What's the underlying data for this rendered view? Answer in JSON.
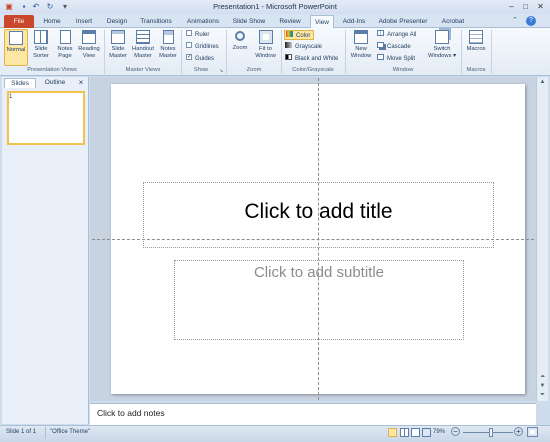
{
  "window": {
    "title": "Presentation1 - Microsoft PowerPoint",
    "quick_access": [
      "save-icon",
      "undo-icon",
      "redo-icon",
      "customize-icon"
    ],
    "controls": {
      "minimize": "–",
      "maximize": "□",
      "close": "✕"
    }
  },
  "tabs": [
    "File",
    "Home",
    "Insert",
    "Design",
    "Transitions",
    "Animations",
    "Slide Show",
    "Review",
    "View",
    "Add-Ins",
    "Adobe Presenter",
    "Acrobat"
  ],
  "active_tab": "View",
  "ribbon": {
    "presentation_views": {
      "label": "Presentation Views",
      "normal": "Normal",
      "slide_sorter": [
        "Slide",
        "Sorter"
      ],
      "notes_page": [
        "Notes",
        "Page"
      ],
      "reading_view": [
        "Reading",
        "View"
      ]
    },
    "master_views": {
      "label": "Master Views",
      "slide_master": [
        "Slide",
        "Master"
      ],
      "handout_master": [
        "Handout",
        "Master"
      ],
      "notes_master": [
        "Notes",
        "Master"
      ]
    },
    "show": {
      "label": "Show",
      "ruler": "Ruler",
      "gridlines": "Gridlines",
      "guides": "Guides",
      "ruler_checked": false,
      "gridlines_checked": false,
      "guides_checked": true
    },
    "zoom": {
      "label": "Zoom",
      "zoom": "Zoom",
      "fit_to_window": [
        "Fit to",
        "Window"
      ]
    },
    "color_grayscale": {
      "label": "Color/Grayscale",
      "color": "Color",
      "grayscale": "Grayscale",
      "black_and_white": "Black and White"
    },
    "window": {
      "label": "Window",
      "new_window": [
        "New",
        "Window"
      ],
      "arrange_all": "Arrange All",
      "cascade": "Cascade",
      "move_split": "Move Split",
      "switch_windows": [
        "Switch",
        "Windows ▾"
      ]
    },
    "macros": {
      "label": "Macros",
      "macros": "Macros"
    }
  },
  "panel": {
    "tabs": [
      "Slides",
      "Outline"
    ],
    "close": "×",
    "slide_number": "1"
  },
  "slide": {
    "title_placeholder": "Click to add title",
    "subtitle_placeholder": "Click to add subtitle"
  },
  "notes": {
    "placeholder": "Click to add notes"
  },
  "status": {
    "slide_info": "Slide 1 of 1",
    "theme": "\"Office Theme\"",
    "zoom_level": "79%",
    "zoom_fraction": 0.55
  },
  "colors": {
    "file_tab": "#c9472b",
    "active_button": "#fde7a3",
    "ribbon_bg": "#e3ebf5"
  }
}
